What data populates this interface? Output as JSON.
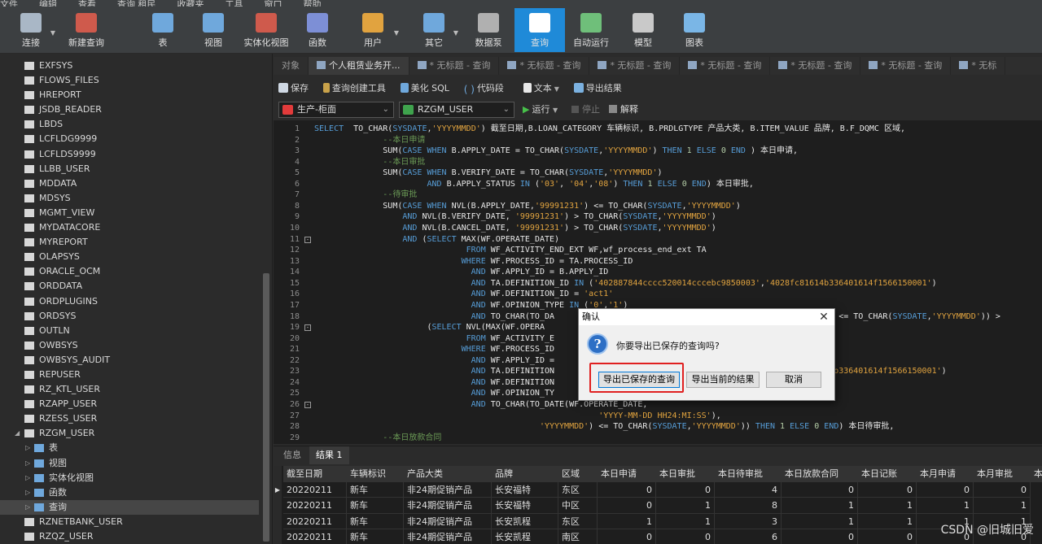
{
  "menu": [
    "文件",
    "编辑",
    "查看",
    "查询 租民",
    "收藏夹",
    "工具",
    "窗口",
    "帮助"
  ],
  "toolbar": [
    {
      "label": "连接",
      "icon": "plug-icon",
      "dropdown": true
    },
    {
      "label": "新建查询",
      "icon": "new-query-icon",
      "dropdown": false
    },
    {
      "label": "表",
      "icon": "table-icon",
      "dropdown": false
    },
    {
      "label": "视图",
      "icon": "view-icon",
      "dropdown": false
    },
    {
      "label": "实体化视图",
      "icon": "materialized-view-icon",
      "dropdown": false
    },
    {
      "label": "函数",
      "icon": "function-icon",
      "dropdown": false
    },
    {
      "label": "用户",
      "icon": "user-icon",
      "dropdown": true
    },
    {
      "label": "其它",
      "icon": "tools-icon",
      "dropdown": true
    },
    {
      "label": "数据泵",
      "icon": "datapump-icon",
      "dropdown": false
    },
    {
      "label": "查询",
      "icon": "query-icon",
      "dropdown": false,
      "active": true
    },
    {
      "label": "自动运行",
      "icon": "autorun-icon",
      "dropdown": false
    },
    {
      "label": "模型",
      "icon": "model-icon",
      "dropdown": false
    },
    {
      "label": "图表",
      "icon": "chart-icon",
      "dropdown": false
    }
  ],
  "sidebar": {
    "items": [
      {
        "label": "EXFSYS"
      },
      {
        "label": "FLOWS_FILES"
      },
      {
        "label": "HREPORT"
      },
      {
        "label": "JSDB_READER"
      },
      {
        "label": "LBDS"
      },
      {
        "label": "LCFLDG9999"
      },
      {
        "label": "LCFLDS9999"
      },
      {
        "label": "LLBB_USER"
      },
      {
        "label": "MDDATA"
      },
      {
        "label": "MDSYS"
      },
      {
        "label": "MGMT_VIEW"
      },
      {
        "label": "MYDATACORE"
      },
      {
        "label": "MYREPORT"
      },
      {
        "label": "OLAPSYS"
      },
      {
        "label": "ORACLE_OCM"
      },
      {
        "label": "ORDDATA"
      },
      {
        "label": "ORDPLUGINS"
      },
      {
        "label": "ORDSYS"
      },
      {
        "label": "OUTLN"
      },
      {
        "label": "OWBSYS"
      },
      {
        "label": "OWBSYS_AUDIT"
      },
      {
        "label": "REPUSER"
      },
      {
        "label": "RZ_KTL_USER"
      },
      {
        "label": "RZAPP_USER"
      },
      {
        "label": "RZESS_USER"
      },
      {
        "label": "RZGM_USER",
        "expanded": true
      },
      {
        "label": "表",
        "child": true
      },
      {
        "label": "视图",
        "child": true
      },
      {
        "label": "实体化视图",
        "child": true
      },
      {
        "label": "函数",
        "child": true
      },
      {
        "label": "查询",
        "child": true,
        "selected": true
      },
      {
        "label": "RZNETBANK_USER"
      },
      {
        "label": "RZQZ_USER"
      }
    ]
  },
  "tabs": [
    {
      "label": "对象",
      "active": false
    },
    {
      "label": "个人租赁业务开...",
      "active": true
    },
    {
      "label": "* 无标题 - 查询",
      "active": false
    },
    {
      "label": "* 无标题 - 查询",
      "active": false
    },
    {
      "label": "* 无标题 - 查询",
      "active": false
    },
    {
      "label": "* 无标题 - 查询",
      "active": false
    },
    {
      "label": "* 无标题 - 查询",
      "active": false
    },
    {
      "label": "* 无标题 - 查询",
      "active": false
    },
    {
      "label": "* 无标"
    }
  ],
  "editor_toolbar": {
    "save": "保存",
    "builder": "查询创建工具",
    "beautify": "美化 SQL",
    "snippet": "代码段",
    "text": "文本",
    "export": "导出结果"
  },
  "connection": {
    "server": "生产-柜面",
    "schema": "RZGM_USER",
    "run": "运行",
    "stop": "停止",
    "explain": "解释"
  },
  "code_lines": [
    {
      "n": "1",
      "html": "<span class=\"kw\">SELECT</span>  TO_CHAR(<span class=\"kw\">SYSDATE</span>,<span class=\"str\">'YYYYMMDD'</span>) 截至日期,B.LOAN_CATEGORY 车辆标识, B.PRDLGTYPE 产品大类, B.ITEM_VALUE 品牌, B.F_DQMC 区域,"
    },
    {
      "n": "2",
      "html": "              <span class=\"cmt\">--本日申请</span>"
    },
    {
      "n": "3",
      "html": "              SUM(<span class=\"kw\">CASE WHEN</span> B.APPLY_DATE = TO_CHAR(<span class=\"kw\">SYSDATE</span>,<span class=\"str\">'YYYYMMDD'</span>) <span class=\"kw\">THEN</span> <span class=\"num\">1</span> <span class=\"kw\">ELSE</span> <span class=\"num\">0</span> <span class=\"kw\">END</span> ) 本日申请,"
    },
    {
      "n": "4",
      "html": "              <span class=\"cmt\">--本日审批</span>"
    },
    {
      "n": "5",
      "html": "              SUM(<span class=\"kw\">CASE WHEN</span> B.VERIFY_DATE = TO_CHAR(<span class=\"kw\">SYSDATE</span>,<span class=\"str\">'YYYYMMDD'</span>)"
    },
    {
      "n": "6",
      "html": "                       <span class=\"kw\">AND</span> B.APPLY_STATUS <span class=\"kw\">IN</span> (<span class=\"str\">'03'</span>, <span class=\"str\">'04'</span>,<span class=\"str\">'08'</span>) <span class=\"kw\">THEN</span> <span class=\"num\">1</span> <span class=\"kw\">ELSE</span> <span class=\"num\">0</span> <span class=\"kw\">END</span>) 本日审批,"
    },
    {
      "n": "7",
      "html": "              <span class=\"cmt\">--待审批</span>"
    },
    {
      "n": "8",
      "html": "              SUM(<span class=\"kw\">CASE WHEN</span> NVL(B.APPLY_DATE,<span class=\"str\">'99991231'</span>) &lt;= TO_CHAR(<span class=\"kw\">SYSDATE</span>,<span class=\"str\">'YYYYMMDD'</span>)"
    },
    {
      "n": "9",
      "html": "                  <span class=\"kw\">AND</span> NVL(B.VERIFY_DATE, <span class=\"str\">'99991231'</span>) &gt; TO_CHAR(<span class=\"kw\">SYSDATE</span>,<span class=\"str\">'YYYYMMDD'</span>)"
    },
    {
      "n": "10",
      "html": "                  <span class=\"kw\">AND</span> NVL(B.CANCEL_DATE, <span class=\"str\">'99991231'</span>) &gt; TO_CHAR(<span class=\"kw\">SYSDATE</span>,<span class=\"str\">'YYYYMMDD'</span>)"
    },
    {
      "n": "11",
      "fold": "-",
      "html": "                  <span class=\"kw\">AND</span> (<span class=\"kw\">SELECT</span> MAX(WF.OPERATE_DATE)"
    },
    {
      "n": "12",
      "html": "                               <span class=\"kw\">FROM</span> WF_ACTIVITY_END_EXT WF,wf_process_end_ext TA"
    },
    {
      "n": "13",
      "html": "                              <span class=\"kw\">WHERE</span> WF.PROCESS_ID = TA.PROCESS_ID"
    },
    {
      "n": "14",
      "html": "                                <span class=\"kw\">AND</span> WF.APPLY_ID = B.APPLY_ID"
    },
    {
      "n": "15",
      "html": "                                <span class=\"kw\">AND</span> TA.DEFINITION_ID <span class=\"kw\">IN</span> (<span class=\"str\">'402887844cccc520014cccebc9850003'</span>,<span class=\"str\">'4028fc81614b336401614f1566150001'</span>)"
    },
    {
      "n": "16",
      "html": "                                <span class=\"kw\">AND</span> WF.DEFINITION_ID = <span class=\"str\">'act1'</span>"
    },
    {
      "n": "17",
      "html": "                                <span class=\"kw\">AND</span> WF.OPINION_TYPE <span class=\"kw\">IN</span> (<span class=\"str\">'0'</span>,<span class=\"str\">'1'</span>)"
    },
    {
      "n": "18",
      "html": "                                <span class=\"kw\">AND</span> TO_CHAR(TO_DA                                                   <span class=\"str\">MMDD'</span>) &lt;= TO_CHAR(<span class=\"kw\">SYSDATE</span>,<span class=\"str\">'YYYYMMDD'</span>)) &gt;"
    },
    {
      "n": "19",
      "fold": "-",
      "html": "                       (<span class=\"kw\">SELECT</span> NVL(MAX(WF.OPERA"
    },
    {
      "n": "20",
      "html": "                               <span class=\"kw\">FROM</span> WF_ACTIVITY_E"
    },
    {
      "n": "21",
      "html": "                              <span class=\"kw\">WHERE</span> WF.PROCESS_ID"
    },
    {
      "n": "22",
      "html": "                                <span class=\"kw\">AND</span> WF.APPLY_ID ="
    },
    {
      "n": "23",
      "html": "                                <span class=\"kw\">AND</span> TA.DEFINITION                                                   <span class=\"str\">c81614b336401614f1566150001'</span>)"
    },
    {
      "n": "24",
      "html": "                                <span class=\"kw\">AND</span> WF.DEFINITION"
    },
    {
      "n": "25",
      "html": "                                <span class=\"kw\">AND</span> WF.OPINION_TY"
    },
    {
      "n": "26",
      "fold": "-",
      "html": "                                <span class=\"kw\">AND</span> TO_CHAR(TO_DATE(WF.OPERATE_DATE,"
    },
    {
      "n": "27",
      "html": "                                                          <span class=\"str\">'YYYY-MM-DD HH24:MI:SS'</span>),"
    },
    {
      "n": "28",
      "html": "                                              <span class=\"str\">'YYYYMMDD'</span>) &lt;= TO_CHAR(<span class=\"kw\">SYSDATE</span>,<span class=\"str\">'YYYYMMDD'</span>)) <span class=\"kw\">THEN</span> <span class=\"num\">1</span> <span class=\"kw\">ELSE</span> <span class=\"num\">0</span> <span class=\"kw\">END</span>) 本日待审批,"
    },
    {
      "n": "29",
      "html": "              <span class=\"cmt\">--本日放款合同</span>"
    }
  ],
  "result_tabs": {
    "info": "信息",
    "result": "结果 1"
  },
  "grid": {
    "columns": [
      "截至日期",
      "车辆标识",
      "产品大类",
      "品牌",
      "区域",
      "本日申请",
      "本日审批",
      "本日待审批",
      "本日放款合同",
      "本日记账",
      "本月申请",
      "本月审批",
      "本"
    ],
    "rows": [
      [
        "20220211",
        "新车",
        "非24期促销产品",
        "长安福特",
        "东区",
        "0",
        "0",
        "4",
        "0",
        "0",
        "0",
        "0"
      ],
      [
        "20220211",
        "新车",
        "非24期促销产品",
        "长安福特",
        "中区",
        "0",
        "1",
        "8",
        "1",
        "1",
        "1",
        "1"
      ],
      [
        "20220211",
        "新车",
        "非24期促销产品",
        "长安凯程",
        "东区",
        "1",
        "1",
        "3",
        "1",
        "1",
        "1",
        "1"
      ],
      [
        "20220211",
        "新车",
        "非24期促销产品",
        "长安凯程",
        "南区",
        "0",
        "0",
        "6",
        "0",
        "0",
        "0",
        "0"
      ]
    ]
  },
  "dialog": {
    "title": "确认",
    "message": "你要导出已保存的查询吗?",
    "btn_saved": "导出已保存的查询",
    "btn_current": "导出当前的结果",
    "btn_cancel": "取消"
  },
  "watermark": "CSDN @旧城旧爱"
}
